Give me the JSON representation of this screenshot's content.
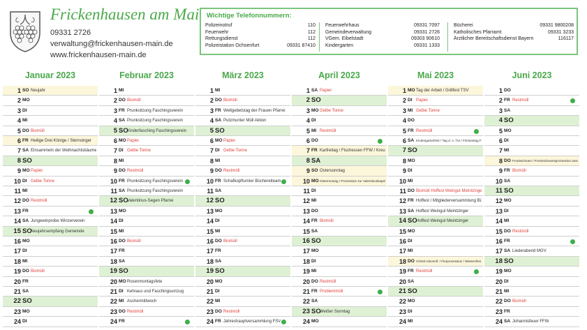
{
  "header": {
    "town_name": "Frickenhausen am Main",
    "phone": "09331 2726",
    "email": "verwaltung@frickenhausen-main.de",
    "website": "www.frickenhausen-main.de",
    "crest_icon": "town-crest-grapes-icon"
  },
  "phone_box": {
    "title": "Wichtige Telefonnummern:",
    "border_color": "#7cc47c",
    "columns": [
      [
        {
          "name": "Polizeinotruf",
          "number": "110"
        },
        {
          "name": "Feuerwehr",
          "number": "112"
        },
        {
          "name": "Rettungsdienst",
          "number": "112"
        },
        {
          "name": "Polizeistation Ochsenfurt",
          "number": "09331 87410"
        }
      ],
      [
        {
          "name": "Feuerwehrhaus",
          "number": "09331 7097"
        },
        {
          "name": "Gemeindeverwaltung",
          "number": "09331 2726"
        },
        {
          "name": "VGem. Eibelstadt",
          "number": "09303 90610"
        },
        {
          "name": "Kindergarten",
          "number": "09331 1333"
        }
      ],
      [
        {
          "name": "Bücherei",
          "number": "09331 9800208"
        },
        {
          "name": "Katholisches Pfarramt",
          "number": "09331 3233"
        },
        {
          "name": "Ärztlicher Bereitschaftsdienst Bayern",
          "number": "116117"
        }
      ]
    ]
  },
  "colors": {
    "accent_green": "#4aa84a",
    "sunday_bg": "#dff1d4",
    "holiday_bg": "#fcf6db",
    "waste_red": "#e0413a",
    "dot_green": "#3fae4a"
  },
  "months": [
    {
      "title": "Januar 2023",
      "days": [
        {
          "n": "1",
          "w": "SO",
          "ev": "Neujahr",
          "sun": true,
          "hol": true
        },
        {
          "n": "2",
          "w": "MO",
          "ev": ""
        },
        {
          "n": "3",
          "w": "DI",
          "ev": ""
        },
        {
          "n": "4",
          "w": "MI",
          "ev": ""
        },
        {
          "n": "5",
          "w": "DO",
          "ev": "Biomüll",
          "red": true
        },
        {
          "n": "6",
          "w": "FR",
          "ev": "Heilige Drei Könige / Sternsinger",
          "hol": true
        },
        {
          "n": "7",
          "w": "SA",
          "ev": "Einsammeln der Weihnachtsbäume FFW"
        },
        {
          "n": "8",
          "w": "SO",
          "ev": "",
          "sun": true
        },
        {
          "n": "9",
          "w": "MO",
          "ev": "Papier",
          "red": true
        },
        {
          "n": "10",
          "w": "DI",
          "ev": "Gelbe Tonne",
          "red": true
        },
        {
          "n": "11",
          "w": "MI",
          "ev": ""
        },
        {
          "n": "12",
          "w": "DO",
          "ev": "Restmüll",
          "red": true
        },
        {
          "n": "13",
          "w": "FR",
          "ev": "",
          "dot": true
        },
        {
          "n": "14",
          "w": "SA",
          "ev": "Jungweinprobe Winzerverein"
        },
        {
          "n": "15",
          "w": "SO",
          "ev": "Neujahrsempfang Gemeinde",
          "sun": true
        },
        {
          "n": "16",
          "w": "MO",
          "ev": ""
        },
        {
          "n": "17",
          "w": "DI",
          "ev": ""
        },
        {
          "n": "18",
          "w": "MI",
          "ev": ""
        },
        {
          "n": "19",
          "w": "DO",
          "ev": "Biomüll",
          "red": true
        },
        {
          "n": "20",
          "w": "FR",
          "ev": ""
        },
        {
          "n": "21",
          "w": "SA",
          "ev": ""
        },
        {
          "n": "22",
          "w": "SO",
          "ev": "",
          "sun": true
        },
        {
          "n": "23",
          "w": "MO",
          "ev": ""
        },
        {
          "n": "24",
          "w": "DI",
          "ev": ""
        }
      ]
    },
    {
      "title": "Februar 2023",
      "days": [
        {
          "n": "1",
          "w": "MI",
          "ev": ""
        },
        {
          "n": "2",
          "w": "DO",
          "ev": "Biomüll",
          "red": true
        },
        {
          "n": "3",
          "w": "FR",
          "ev": "Prunksitzung Faschingsverein"
        },
        {
          "n": "4",
          "w": "SA",
          "ev": "Prunksitzung Faschingsverein"
        },
        {
          "n": "5",
          "w": "SO",
          "ev": "Kinderfasching Faschingsverein",
          "sun": true
        },
        {
          "n": "6",
          "w": "MO",
          "ev": "Papier",
          "red": true
        },
        {
          "n": "7",
          "w": "DI",
          "ev": "Gelbe Tonne",
          "red": true
        },
        {
          "n": "8",
          "w": "MI",
          "ev": ""
        },
        {
          "n": "9",
          "w": "DO",
          "ev": "Restmüll",
          "red": true
        },
        {
          "n": "10",
          "w": "FR",
          "ev": "Prunksitzung Faschingsverein",
          "dot": true
        },
        {
          "n": "11",
          "w": "SA",
          "ev": "Prunksitzung Faschingsverein"
        },
        {
          "n": "12",
          "w": "SO",
          "ev": "Valentinus-Segen Pfarrei",
          "sun": true
        },
        {
          "n": "13",
          "w": "MO",
          "ev": ""
        },
        {
          "n": "14",
          "w": "DI",
          "ev": ""
        },
        {
          "n": "15",
          "w": "MI",
          "ev": ""
        },
        {
          "n": "16",
          "w": "DO",
          "ev": "Biomüll",
          "red": true
        },
        {
          "n": "17",
          "w": "FR",
          "ev": ""
        },
        {
          "n": "18",
          "w": "SA",
          "ev": ""
        },
        {
          "n": "19",
          "w": "SO",
          "ev": "",
          "sun": true
        },
        {
          "n": "20",
          "w": "MO",
          "ev": "Rosenmontagsfete"
        },
        {
          "n": "21",
          "w": "DI",
          "ev": "Kehraus und Faschingsumzug"
        },
        {
          "n": "22",
          "w": "MI",
          "ev": "Aschermittwoch"
        },
        {
          "n": "23",
          "w": "DO",
          "ev": "Restmüll",
          "red": true
        },
        {
          "n": "24",
          "w": "FR",
          "ev": "",
          "dot": true
        }
      ]
    },
    {
      "title": "März 2023",
      "days": [
        {
          "n": "1",
          "w": "MI",
          "ev": ""
        },
        {
          "n": "2",
          "w": "DO",
          "ev": "Biomüll",
          "red": true
        },
        {
          "n": "3",
          "w": "FR",
          "ev": "Weltgebetstag der Frauen Pfarrei"
        },
        {
          "n": "4",
          "w": "SA",
          "ev": "Putzmunter Müll Aktion"
        },
        {
          "n": "5",
          "w": "SO",
          "ev": "",
          "sun": true
        },
        {
          "n": "6",
          "w": "MO",
          "ev": "Papier",
          "red": true
        },
        {
          "n": "7",
          "w": "DI",
          "ev": "Gelbe Tonne",
          "red": true
        },
        {
          "n": "8",
          "w": "MI",
          "ev": ""
        },
        {
          "n": "9",
          "w": "DO",
          "ev": "Restmüll",
          "red": true
        },
        {
          "n": "10",
          "w": "FR",
          "ev": "Schafkopfturnier Büchereiteam",
          "dot": true
        },
        {
          "n": "11",
          "w": "SA",
          "ev": ""
        },
        {
          "n": "12",
          "w": "SO",
          "ev": "",
          "sun": true
        },
        {
          "n": "13",
          "w": "MO",
          "ev": ""
        },
        {
          "n": "14",
          "w": "DI",
          "ev": ""
        },
        {
          "n": "15",
          "w": "MI",
          "ev": ""
        },
        {
          "n": "16",
          "w": "DO",
          "ev": "Biomüll",
          "red": true
        },
        {
          "n": "17",
          "w": "FR",
          "ev": ""
        },
        {
          "n": "18",
          "w": "SA",
          "ev": ""
        },
        {
          "n": "19",
          "w": "SO",
          "ev": "",
          "sun": true
        },
        {
          "n": "20",
          "w": "MO",
          "ev": ""
        },
        {
          "n": "21",
          "w": "DI",
          "ev": ""
        },
        {
          "n": "22",
          "w": "MI",
          "ev": ""
        },
        {
          "n": "23",
          "w": "DO",
          "ev": "Restmüll",
          "red": true
        },
        {
          "n": "24",
          "w": "FR",
          "ev": "Jahreshauptversammlung FSV",
          "dot": true
        }
      ]
    },
    {
      "title": "April 2023",
      "days": [
        {
          "n": "1",
          "w": "SA",
          "ev": "Papier",
          "red": true
        },
        {
          "n": "2",
          "w": "SO",
          "ev": "",
          "sun": true
        },
        {
          "n": "3",
          "w": "MO",
          "ev": "Gelbe Tonne",
          "red": true
        },
        {
          "n": "4",
          "w": "DI",
          "ev": ""
        },
        {
          "n": "5",
          "w": "MI",
          "ev": "Restmüll",
          "red": true
        },
        {
          "n": "6",
          "w": "DO",
          "ev": "",
          "dot": true
        },
        {
          "n": "7",
          "w": "FR",
          "ev": "Karfreitag / Fischessen FFW / Kreuzweg",
          "hol": true
        },
        {
          "n": "8",
          "w": "SA",
          "ev": "",
          "sun": true
        },
        {
          "n": "9",
          "w": "SO",
          "ev": "Ostersonntag",
          "hol": true
        },
        {
          "n": "10",
          "w": "MO",
          "ev": "Ostermontag / Prozession zur Valentinuskapelle",
          "hol": true,
          "sm": true
        },
        {
          "n": "11",
          "w": "DI",
          "ev": ""
        },
        {
          "n": "12",
          "w": "MI",
          "ev": ""
        },
        {
          "n": "13",
          "w": "DO",
          "ev": ""
        },
        {
          "n": "14",
          "w": "FR",
          "ev": "Biomüll",
          "red": true
        },
        {
          "n": "15",
          "w": "SA",
          "ev": ""
        },
        {
          "n": "16",
          "w": "SO",
          "ev": "",
          "sun": true
        },
        {
          "n": "17",
          "w": "MO",
          "ev": ""
        },
        {
          "n": "18",
          "w": "DI",
          "ev": ""
        },
        {
          "n": "19",
          "w": "MI",
          "ev": ""
        },
        {
          "n": "20",
          "w": "DO",
          "ev": "Restmüll",
          "red": true
        },
        {
          "n": "21",
          "w": "FR",
          "ev": "Problemmüll",
          "red": true,
          "dot": true
        },
        {
          "n": "22",
          "w": "SA",
          "ev": ""
        },
        {
          "n": "23",
          "w": "SO",
          "ev": "Weißer Sonntag",
          "sun": true
        },
        {
          "n": "24",
          "w": "MO",
          "ev": ""
        }
      ]
    },
    {
      "title": "Mai 2023",
      "days": [
        {
          "n": "1",
          "w": "MO",
          "ev": "Tag der Arbeit / Grillfest TSV",
          "hol": true
        },
        {
          "n": "2",
          "w": "DI",
          "ev": "Papier",
          "red": true
        },
        {
          "n": "3",
          "w": "MI",
          "ev": "Gelbe Tonne",
          "red": true
        },
        {
          "n": "4",
          "w": "DO",
          "ev": ""
        },
        {
          "n": "5",
          "w": "FR",
          "ev": "Restmüll",
          "red": true,
          "dot": true
        },
        {
          "n": "6",
          "w": "SA",
          "ev": "Kindergartenfest / Tag d. o. Tür / Florianstag FFW",
          "sm": true
        },
        {
          "n": "7",
          "w": "SO",
          "ev": "",
          "sun": true
        },
        {
          "n": "8",
          "w": "MO",
          "ev": ""
        },
        {
          "n": "9",
          "w": "DI",
          "ev": ""
        },
        {
          "n": "10",
          "w": "MI",
          "ev": ""
        },
        {
          "n": "11",
          "w": "DO",
          "ev": "Biomüll Hoffest Weingut Meintzinger",
          "red": true
        },
        {
          "n": "12",
          "w": "FR",
          "ev": "Hoffest / Mitgliederversammlung Bürgerverein"
        },
        {
          "n": "13",
          "w": "SA",
          "ev": "Hoffest Weingut Meintzinger"
        },
        {
          "n": "14",
          "w": "SO",
          "ev": "Hoffest Weingut Meintzinger",
          "sun": true
        },
        {
          "n": "15",
          "w": "MO",
          "ev": ""
        },
        {
          "n": "16",
          "w": "DI",
          "ev": ""
        },
        {
          "n": "17",
          "w": "MI",
          "ev": ""
        },
        {
          "n": "18",
          "w": "DO",
          "ev": "Christi Himmelf. / Flurprozession / Wiesenfest",
          "hol": true,
          "sm": true
        },
        {
          "n": "19",
          "w": "FR",
          "ev": "Restmüll",
          "red": true,
          "dot": true
        },
        {
          "n": "20",
          "w": "SA",
          "ev": ""
        },
        {
          "n": "21",
          "w": "SO",
          "ev": "",
          "sun": true
        },
        {
          "n": "22",
          "w": "MO",
          "ev": ""
        },
        {
          "n": "23",
          "w": "DI",
          "ev": ""
        },
        {
          "n": "24",
          "w": "MI",
          "ev": ""
        }
      ]
    },
    {
      "title": "Juni 2023",
      "days": [
        {
          "n": "1",
          "w": "DO",
          "ev": ""
        },
        {
          "n": "2",
          "w": "FR",
          "ev": "Restmüll",
          "red": true,
          "dot": true
        },
        {
          "n": "3",
          "w": "SA",
          "ev": ""
        },
        {
          "n": "4",
          "w": "SO",
          "ev": "",
          "sun": true
        },
        {
          "n": "5",
          "w": "MO",
          "ev": ""
        },
        {
          "n": "6",
          "w": "DI",
          "ev": ""
        },
        {
          "n": "7",
          "w": "MI",
          "ev": ""
        },
        {
          "n": "8",
          "w": "DO",
          "ev": "Fronleichnam / Fronleichnamsprozession anschl. Pfarrfest",
          "hol": true,
          "sm": true
        },
        {
          "n": "9",
          "w": "FR",
          "ev": "Biomüll",
          "red": true
        },
        {
          "n": "10",
          "w": "SA",
          "ev": ""
        },
        {
          "n": "11",
          "w": "SO",
          "ev": "",
          "sun": true
        },
        {
          "n": "12",
          "w": "MO",
          "ev": ""
        },
        {
          "n": "13",
          "w": "DI",
          "ev": ""
        },
        {
          "n": "14",
          "w": "MI",
          "ev": ""
        },
        {
          "n": "15",
          "w": "DO",
          "ev": "Restmüll",
          "red": true
        },
        {
          "n": "16",
          "w": "FR",
          "ev": "",
          "dot": true
        },
        {
          "n": "17",
          "w": "SA",
          "ev": "Liederabend MGV"
        },
        {
          "n": "18",
          "w": "SO",
          "ev": "",
          "sun": true
        },
        {
          "n": "19",
          "w": "MO",
          "ev": ""
        },
        {
          "n": "20",
          "w": "DI",
          "ev": ""
        },
        {
          "n": "21",
          "w": "MI",
          "ev": ""
        },
        {
          "n": "22",
          "w": "DO",
          "ev": "Biomüll",
          "red": true
        },
        {
          "n": "23",
          "w": "FR",
          "ev": ""
        },
        {
          "n": "24",
          "w": "SA",
          "ev": "Johannisfeuer FFW"
        }
      ]
    }
  ]
}
